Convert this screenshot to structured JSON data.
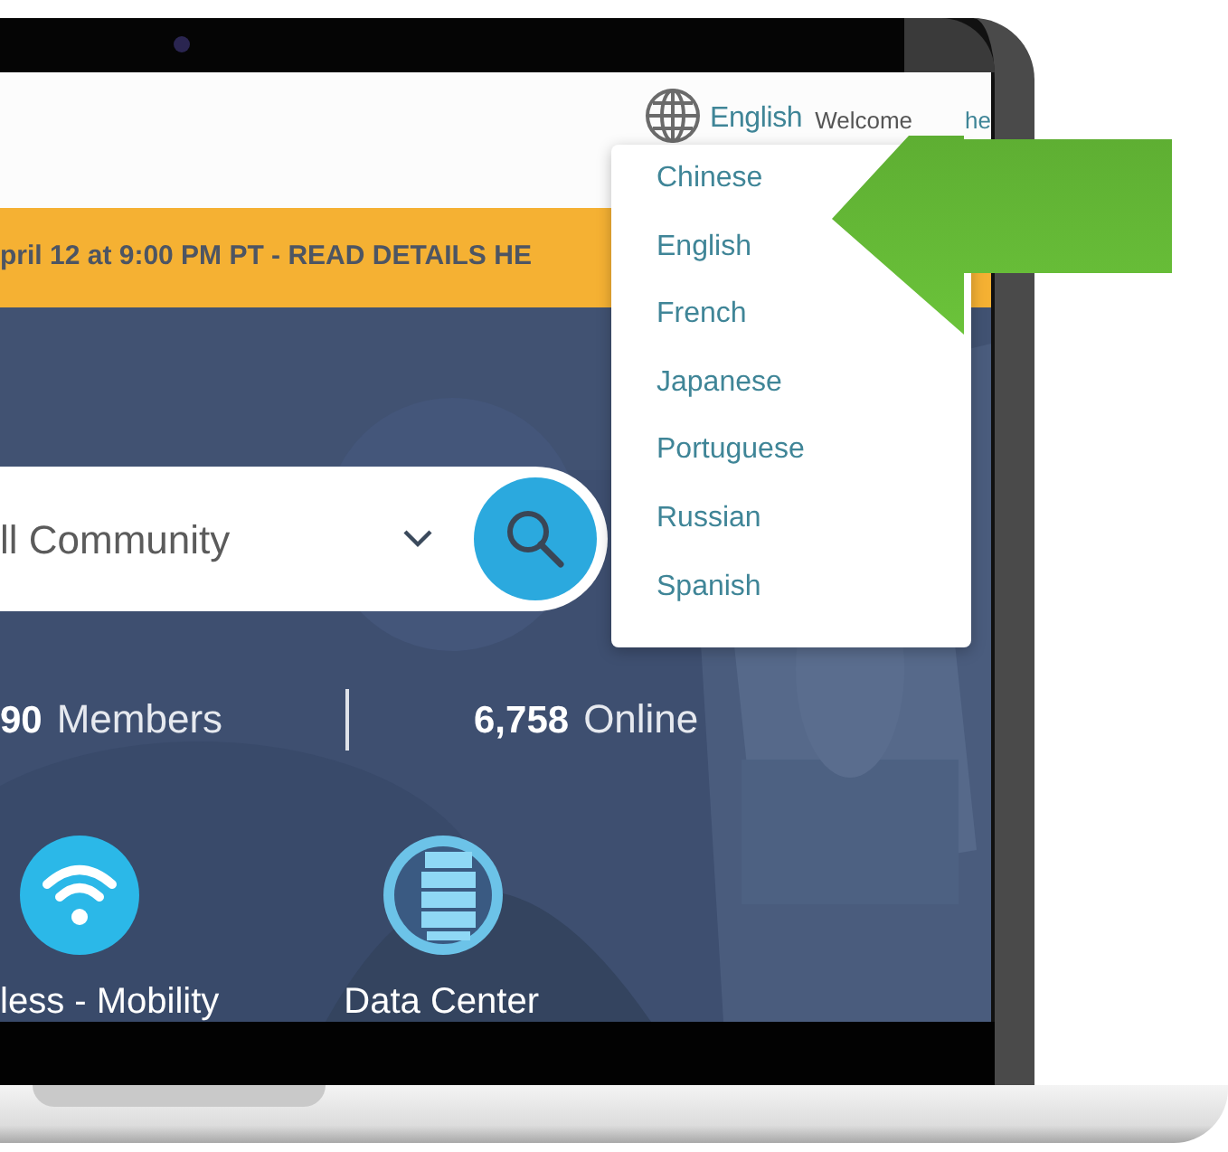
{
  "header": {
    "language": "English",
    "welcome": "Welcome",
    "link_fragment": "he"
  },
  "banner": {
    "text": "pril 12 at 9:00 PM PT - READ DETAILS HE"
  },
  "search": {
    "scope": "ll Community"
  },
  "stats": [
    {
      "number": "90",
      "label": "Members"
    },
    {
      "number": "6,758",
      "label": "Online"
    }
  ],
  "categories": [
    {
      "label": "less - Mobility",
      "kind": "wifi"
    },
    {
      "label": "Data Center",
      "kind": "server"
    }
  ],
  "language_menu": {
    "items": [
      "Chinese",
      "English",
      "French",
      "Japanese",
      "Portuguese",
      "Russian",
      "Spanish"
    ]
  }
}
